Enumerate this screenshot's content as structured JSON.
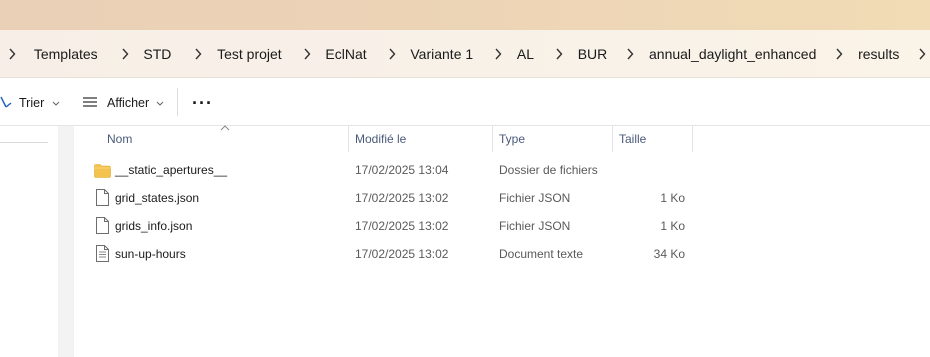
{
  "breadcrumb": {
    "items": [
      "Templates",
      "STD",
      "Test projet",
      "EclNat",
      "Variante 1",
      "AL",
      "BUR",
      "annual_daylight_enhanced",
      "results"
    ]
  },
  "toolbar": {
    "sort_label": "Trier",
    "view_label": "Afficher",
    "more_label": "···"
  },
  "columns": {
    "name": "Nom",
    "modified": "Modifié le",
    "type": "Type",
    "size": "Taille"
  },
  "files": [
    {
      "name": "__static_apertures__",
      "modified": "17/02/2025 13:04",
      "type": "Dossier de fichiers",
      "size": "",
      "icon": "folder-icon"
    },
    {
      "name": "grid_states.json",
      "modified": "17/02/2025 13:02",
      "type": "Fichier JSON",
      "size": "1 Ko",
      "icon": "file-icon"
    },
    {
      "name": "grids_info.json",
      "modified": "17/02/2025 13:02",
      "type": "Fichier JSON",
      "size": "1 Ko",
      "icon": "file-icon"
    },
    {
      "name": "sun-up-hours",
      "modified": "17/02/2025 13:02",
      "type": "Document texte",
      "size": "34 Ko",
      "icon": "text-file-icon"
    }
  ],
  "colors": {
    "folder": "#f3c24f",
    "header_text": "#4a5a7a",
    "accent_bar": "#ecd3b6"
  }
}
